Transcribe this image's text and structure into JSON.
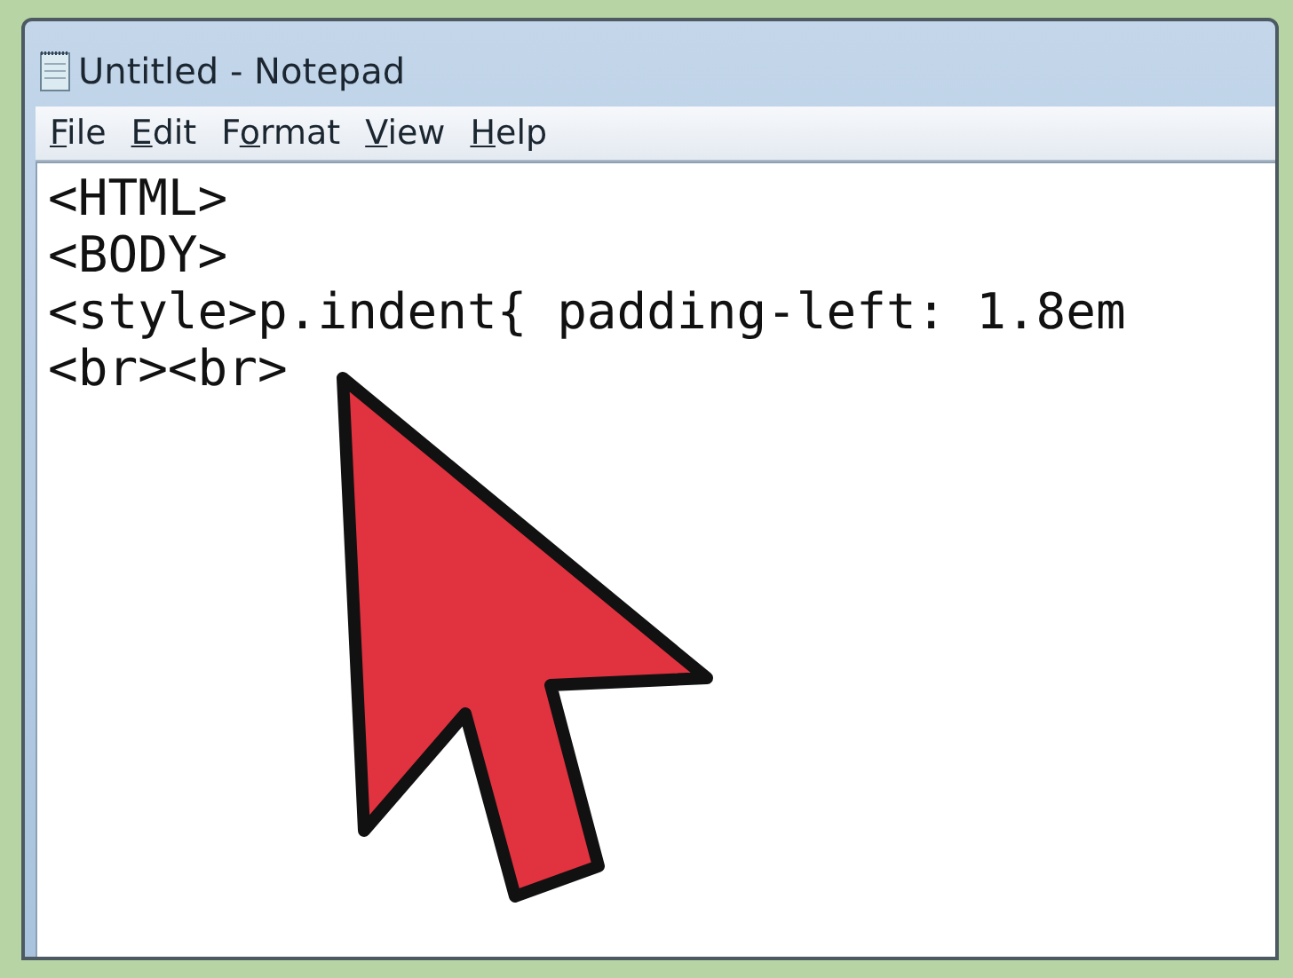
{
  "window": {
    "title": "Untitled - Notepad"
  },
  "menu": [
    {
      "key": "F",
      "tail": "ile"
    },
    {
      "key": "E",
      "tail": "dit"
    },
    {
      "lead": "F",
      "key": "o",
      "tail": "rmat"
    },
    {
      "key": "V",
      "tail": "iew"
    },
    {
      "key": "H",
      "tail": "elp"
    }
  ],
  "editor": {
    "lines": [
      "<HTML>",
      "<BODY>",
      "<style>p.indent{ padding-left: 1.8em",
      "<br><br>"
    ]
  }
}
